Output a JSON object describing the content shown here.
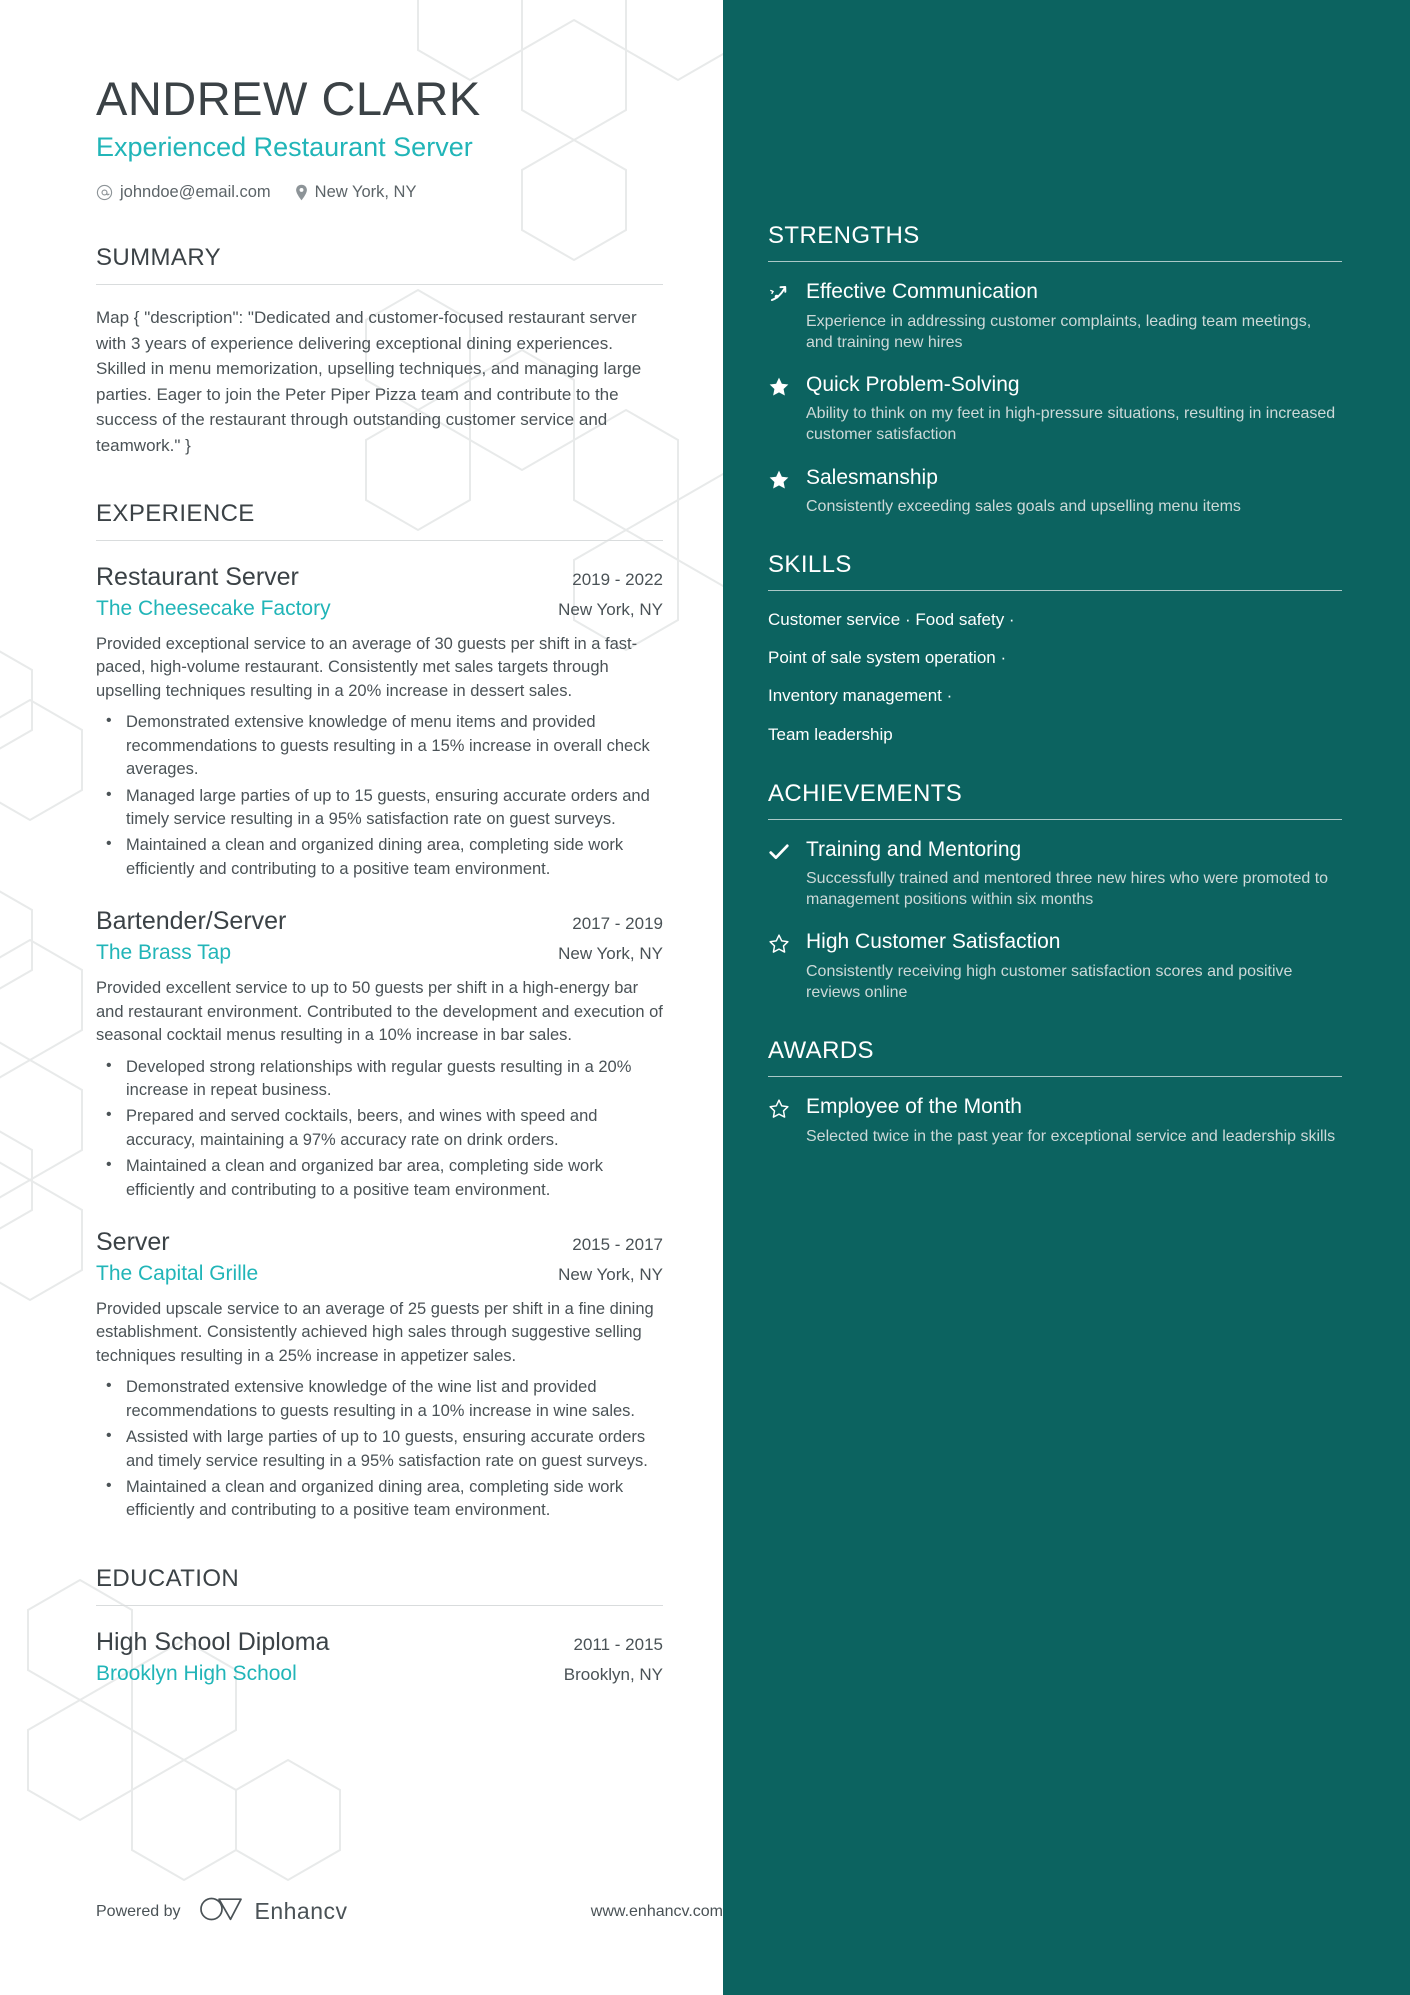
{
  "header": {
    "name": "ANDREW CLARK",
    "headline": "Experienced Restaurant Server",
    "email": "johndoe@email.com",
    "location": "New York, NY"
  },
  "summary": {
    "title": "SUMMARY",
    "text": "Map { \"description\": \"Dedicated and customer-focused restaurant server with 3 years of experience delivering exceptional dining experiences. Skilled in menu memorization, upselling techniques, and managing large parties. Eager to join the Peter Piper Pizza team and contribute to the success of the restaurant through outstanding customer service and teamwork.\" }"
  },
  "experience": {
    "title": "EXPERIENCE",
    "jobs": [
      {
        "title": "Restaurant Server",
        "dates": "2019 - 2022",
        "company": "The Cheesecake Factory",
        "location": "New York, NY",
        "description": "Provided exceptional service to an average of 30 guests per shift in a fast-paced, high-volume restaurant. Consistently met sales targets through upselling techniques resulting in a 20% increase in dessert sales.",
        "bullets": [
          "Demonstrated extensive knowledge of menu items and provided recommendations to guests resulting in a 15% increase in overall check averages.",
          "Managed large parties of up to 15 guests, ensuring accurate orders and timely service resulting in a 95% satisfaction rate on guest surveys.",
          "Maintained a clean and organized dining area, completing side work efficiently and contributing to a positive team environment."
        ]
      },
      {
        "title": "Bartender/Server",
        "dates": "2017 - 2019",
        "company": "The Brass Tap",
        "location": "New York, NY",
        "description": "Provided excellent service to up to 50 guests per shift in a high-energy bar and restaurant environment. Contributed to the development and execution of seasonal cocktail menus resulting in a 10% increase in bar sales.",
        "bullets": [
          "Developed strong relationships with regular guests resulting in a 20% increase in repeat business.",
          "Prepared and served cocktails, beers, and wines with speed and accuracy, maintaining a 97% accuracy rate on drink orders.",
          "Maintained a clean and organized bar area, completing side work efficiently and contributing to a positive team environment."
        ]
      },
      {
        "title": "Server",
        "dates": "2015 - 2017",
        "company": "The Capital Grille",
        "location": "New York, NY",
        "description": "Provided upscale service to an average of 25 guests per shift in a fine dining establishment. Consistently achieved high sales through suggestive selling techniques resulting in a 25% increase in appetizer sales.",
        "bullets": [
          "Demonstrated extensive knowledge of the wine list and provided recommendations to guests resulting in a 10% increase in wine sales.",
          "Assisted with large parties of up to 10 guests, ensuring accurate orders and timely service resulting in a 95% satisfaction rate on guest surveys.",
          "Maintained a clean and organized dining area, completing side work efficiently and contributing to a positive team environment."
        ]
      }
    ]
  },
  "education": {
    "title": "EDUCATION",
    "entries": [
      {
        "degree": "High School Diploma",
        "dates": "2011 - 2015",
        "school": "Brooklyn High School",
        "location": "Brooklyn, NY"
      }
    ]
  },
  "strengths": {
    "title": "STRENGTHS",
    "items": [
      {
        "icon": "rocket-icon",
        "title": "Effective Communication",
        "description": "Experience in addressing customer complaints, leading team meetings, and training new hires"
      },
      {
        "icon": "star-filled-icon",
        "title": "Quick Problem-Solving",
        "description": "Ability to think on my feet in high-pressure situations, resulting in increased customer satisfaction"
      },
      {
        "icon": "star-filled-icon",
        "title": "Salesmanship",
        "description": "Consistently exceeding sales goals and upselling menu items"
      }
    ]
  },
  "skills": {
    "title": "SKILLS",
    "lines": [
      "Customer service · Food safety ·",
      "Point of sale system operation ·",
      "Inventory management ·",
      "Team leadership"
    ]
  },
  "achievements": {
    "title": "ACHIEVEMENTS",
    "items": [
      {
        "icon": "check-icon",
        "title": "Training and Mentoring",
        "description": "Successfully trained and mentored three new hires who were promoted to management positions within six months"
      },
      {
        "icon": "star-outline-icon",
        "title": "High Customer Satisfaction",
        "description": "Consistently receiving high customer satisfaction scores and positive reviews online"
      }
    ]
  },
  "awards": {
    "title": "AWARDS",
    "items": [
      {
        "icon": "star-outline-icon",
        "title": "Employee of the Month",
        "description": "Selected twice in the past year for exceptional service and leadership skills"
      }
    ]
  },
  "footer": {
    "powered_by": "Powered by",
    "brand": "Enhancv",
    "url": "www.enhancv.com"
  },
  "colors": {
    "sidebar_bg": "#0c6360",
    "accent": "#21b5b8",
    "text": "#4a5256",
    "heading": "#3b4246"
  }
}
